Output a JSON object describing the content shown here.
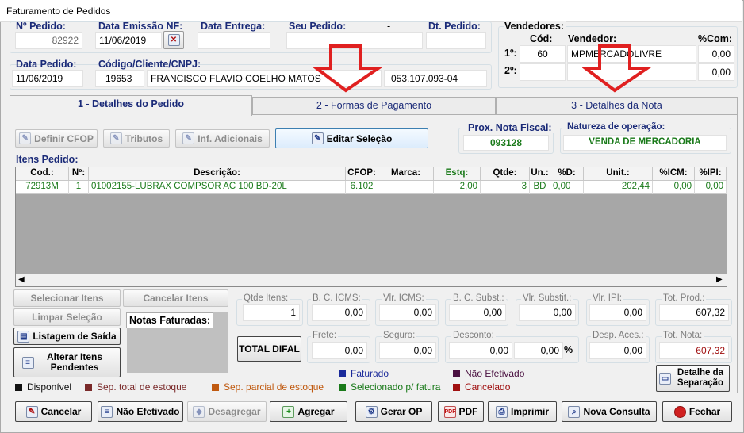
{
  "window": {
    "title": "Faturamento de Pedidos"
  },
  "header": {
    "pedido_label": "Nº Pedido:",
    "pedido_value": "82922",
    "emissao_label": "Data Emissão NF:",
    "emissao_value": "11/06/2019",
    "entrega_label": "Data Entrega:",
    "entrega_value": "",
    "seu_pedido_label": "Seu Pedido:",
    "seu_pedido_sep": "-",
    "seu_pedido_value": "",
    "dt_pedido_label": "Dt. Pedido:",
    "dt_pedido_value": "",
    "data_pedido_label": "Data Pedido:",
    "data_pedido_value": "11/06/2019",
    "cliente_label": "Código/Cliente/CNPJ:",
    "cliente_codigo": "19653",
    "cliente_nome": "FRANCISCO FLAVIO COELHO MATOS",
    "cliente_cnpj": "053.107.093-04"
  },
  "vendedores": {
    "title": "Vendedores:",
    "cod_label": "Cód:",
    "vend_label": "Vendedor:",
    "com_label": "%Com:",
    "rows": [
      {
        "pos": "1º:",
        "cod": "60",
        "nome": "MPMERCADOLIVRE",
        "com": "0,00"
      },
      {
        "pos": "2º:",
        "cod": "",
        "nome": "",
        "com": "0,00"
      }
    ]
  },
  "tabs": [
    {
      "label": "1 - Detalhes do Pedido"
    },
    {
      "label": "2 - Formas de Pagamento"
    },
    {
      "label": "3 - Detalhes da Nota"
    }
  ],
  "actions": {
    "definir_cfop": "Definir CFOP",
    "tributos": "Tributos",
    "inf_adicionais": "Inf. Adicionais",
    "editar_selecao": "Editar Seleção"
  },
  "prox_nota": {
    "label": "Prox. Nota Fiscal:",
    "value": "093128"
  },
  "natureza": {
    "label": "Natureza de operação:",
    "value": "VENDA DE MERCADORIA"
  },
  "itens": {
    "title": "Itens Pedido:",
    "columns": [
      "Cod.:",
      "Nº:",
      "Descrição:",
      "CFOP:",
      "Marca:",
      "Estq:",
      "Qtde:",
      "Un.:",
      "%D:",
      "Unit.:",
      "%ICM:",
      "%IPI:"
    ],
    "rows": [
      {
        "cod": "72913M",
        "n": "1",
        "descricao": "01002155-LUBRAX COMPSOR AC 100 BD-20L",
        "cfop": "6.102",
        "marca": "",
        "estq": "2,00",
        "qtde": "3",
        "un": "BD",
        "d": "0,00",
        "unit": "202,44",
        "icm": "0,00",
        "ipi": "0,00"
      }
    ]
  },
  "side_buttons": {
    "selecionar": "Selecionar Itens",
    "cancelar_itens": "Cancelar Itens",
    "limpar": "Limpar Seleção",
    "listagem": "Listagem de Saída",
    "alterar": "Alterar Itens Pendentes",
    "notas_faturadas": "Notas Faturadas:"
  },
  "totais": {
    "qtde_itens": {
      "label": "Qtde Itens:",
      "value": "1"
    },
    "bc_icms": {
      "label": "B. C. ICMS:",
      "value": "0,00"
    },
    "vlr_icms": {
      "label": "Vlr. ICMS:",
      "value": "0,00"
    },
    "bc_subst": {
      "label": "B. C. Subst.:",
      "value": "0,00"
    },
    "vlr_subst": {
      "label": "Vlr. Substit.:",
      "value": "0,00"
    },
    "vlr_ipi": {
      "label": "Vlr. IPI:",
      "value": "0,00"
    },
    "tot_prod": {
      "label": "Tot. Prod.:",
      "value": "607,32"
    },
    "total_difal": "TOTAL DIFAL",
    "frete": {
      "label": "Frete:",
      "value": "0,00"
    },
    "seguro": {
      "label": "Seguro:",
      "value": "0,00"
    },
    "desconto": {
      "label": "Desconto:",
      "value": "0,00",
      "pct": "0,00",
      "pct_sign": "%"
    },
    "desp_aces": {
      "label": "Desp. Aces.:",
      "value": "0,00"
    },
    "tot_nota": {
      "label": "Tot. Nota:",
      "value": "607,32"
    }
  },
  "detalhe_separacao": "Detalhe da Separação",
  "legend": [
    {
      "label": "Faturado",
      "color": "#1a2a9a"
    },
    {
      "label": "Não Efetivado",
      "color": "#4a1040"
    },
    {
      "label": "Disponível",
      "color": "#111111"
    },
    {
      "label": "Sep. total de estoque",
      "color": "#7a2a2a"
    },
    {
      "label": "Sep. parcial de estoque",
      "color": "#c05a10"
    },
    {
      "label": "Selecionado p/ fatura",
      "color": "#1a7a1a"
    },
    {
      "label": "Cancelado",
      "color": "#a01010"
    }
  ],
  "bottom": {
    "cancelar": "Cancelar",
    "nao_efetivado": "Não Efetivado",
    "desagregar": "Desagregar",
    "agregar": "Agregar",
    "gerar_op": "Gerar OP",
    "pdf": "PDF",
    "imprimir": "Imprimir",
    "nova_consulta": "Nova Consulta",
    "fechar": "Fechar"
  }
}
